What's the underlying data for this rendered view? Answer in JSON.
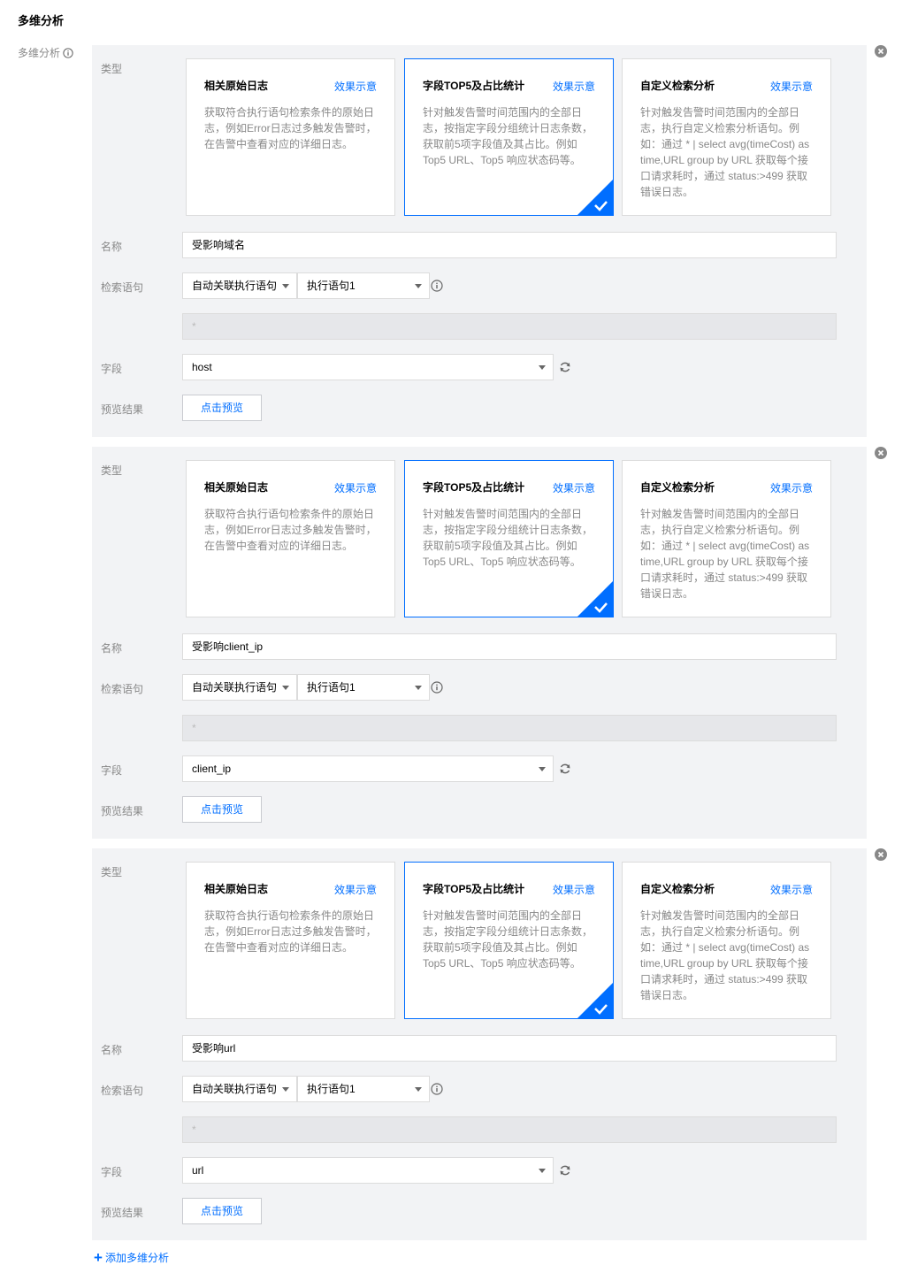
{
  "section_title": "多维分析",
  "side_label": "多维分析",
  "labels": {
    "type": "类型",
    "name": "名称",
    "query": "检索语句",
    "field": "字段",
    "preview": "预览结果"
  },
  "cards": [
    {
      "title": "相关原始日志",
      "link": "效果示意",
      "desc": "获取符合执行语句检索条件的原始日志，例如Error日志过多触发告警时，在告警中查看对应的详细日志。"
    },
    {
      "title": "字段TOP5及占比统计",
      "link": "效果示意",
      "desc": "针对触发告警时间范围内的全部日志，按指定字段分组统计日志条数，获取前5项字段值及其占比。例如Top5 URL、Top5 响应状态码等。"
    },
    {
      "title": "自定义检索分析",
      "link": "效果示意",
      "desc": "针对触发告警时间范围内的全部日志，执行自定义检索分析语句。例如：通过 * | select avg(timeCost) as time,URL group by URL 获取每个接口请求耗时，通过 status:>499 获取错误日志。"
    }
  ],
  "blocks": [
    {
      "name_value": "受影响域名",
      "query_mode": "自动关联执行语句",
      "query_stmt": "执行语句1",
      "query_text": "*",
      "field_value": "host",
      "preview_button": "点击预览",
      "selected_card": 1
    },
    {
      "name_value": "受影响client_ip",
      "query_mode": "自动关联执行语句",
      "query_stmt": "执行语句1",
      "query_text": "*",
      "field_value": "client_ip",
      "preview_button": "点击预览",
      "selected_card": 1
    },
    {
      "name_value": "受影响url",
      "query_mode": "自动关联执行语句",
      "query_stmt": "执行语句1",
      "query_text": "*",
      "field_value": "url",
      "preview_button": "点击预览",
      "selected_card": 1
    }
  ],
  "add_link": "添加多维分析",
  "colors": {
    "accent": "#006eff",
    "block_bg": "#f2f3f5"
  }
}
